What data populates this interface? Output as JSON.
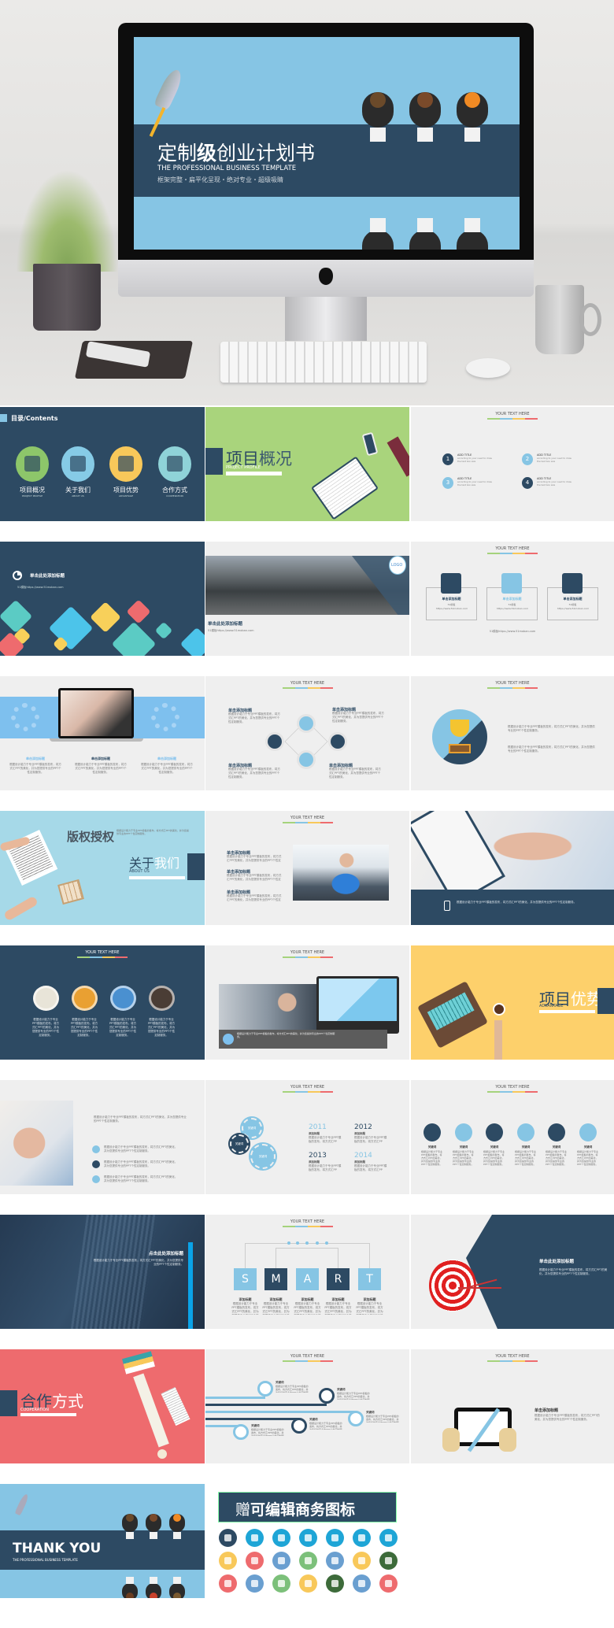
{
  "hero": {
    "title_a": "定制",
    "title_b": "级",
    "title_c": "创业计划书",
    "subtitle": "THE PROFESSIONAL BUSINESS TEMPLATE",
    "tagline": "框架完整・扁平化呈现・绝对专业・超级吸睛"
  },
  "common": {
    "header": "YOUR TEXT HERE",
    "filler": "根据设计能力于专业PPT模板的发布，将方式汇PPT的美化，并为您提供专业的PPT个性定制服务。",
    "url": "51模板https://www.51moban.com",
    "url_short": "51模板 https://www.51moban.com",
    "add_title": "单击添加标题",
    "add_title_here": "单击此处添加标题",
    "click_title_here": "点击此处添加标题",
    "keyword": "关键词",
    "add_heading": "添加标题",
    "logo": "LOGO"
  },
  "colors": {
    "navy": "#2d4a63",
    "light_blue": "#86c5e4",
    "green": "#a9d47c",
    "yellow": "#fdd06b",
    "red": "#ee6b6e",
    "gray": "#efefef"
  },
  "contents": {
    "title": "目录/Contents",
    "items": [
      {
        "label": "项目概况",
        "sub": "PROJECT PROFILE",
        "color": "#8dc66a",
        "icon": "laptop-icon"
      },
      {
        "label": "关于我们",
        "sub": "ABOUT US",
        "color": "#86cbe6",
        "icon": "document-magnifier-icon"
      },
      {
        "label": "项目优势",
        "sub": "ADVANTAGE",
        "color": "#f8c85a",
        "icon": "briefcase-clock-icon"
      },
      {
        "label": "合作方式",
        "sub": "COOPERATION",
        "color": "#8fd3d8",
        "icon": "handshake-icon"
      }
    ]
  },
  "profile": {
    "title_a": "项目",
    "title_b": "概况",
    "sub": "PROJECT PROFILE"
  },
  "numbered": {
    "items": [
      {
        "num": "1",
        "title": "ADD TITLE",
        "desc": "according to your need to draw the text box size",
        "color": "#2d4a63"
      },
      {
        "num": "2",
        "title": "ADD TITLE",
        "desc": "according to your need to draw the text box size",
        "color": "#86c5e4"
      },
      {
        "num": "3",
        "title": "ADD TITLE",
        "desc": "according to your need to draw the text box size",
        "color": "#86c5e4"
      },
      {
        "num": "4",
        "title": "ADD TITLE",
        "desc": "according to your need to draw the text box size",
        "color": "#2d4a63"
      }
    ]
  },
  "three_boxes": {
    "items": [
      {
        "icon": "camera-icon",
        "color": "#2d4a63",
        "label": "51模板"
      },
      {
        "icon": "box-icon",
        "color": "#86c5e4",
        "label": "51模板"
      },
      {
        "icon": "pie-chart-icon",
        "color": "#2d4a63",
        "label": "51模板"
      }
    ]
  },
  "about": {
    "copyright": "版权授权",
    "title_a": "关于",
    "title_b": "我们",
    "sub": "ABOUT US"
  },
  "medals": {
    "items": [
      {
        "icon": "medal-icon",
        "color": "#e8e4d8"
      },
      {
        "icon": "chat-bubble-icon",
        "color": "#e9a032"
      },
      {
        "icon": "tv-icon",
        "color": "#4a90d0"
      },
      {
        "icon": "picture-icon",
        "color": "#4a3d35"
      }
    ]
  },
  "advantage": {
    "title_a": "项目",
    "title_b": "优势",
    "sub": "ADVANTAGE"
  },
  "timeline": {
    "years": [
      {
        "year": "2011",
        "color": "#86c5e4"
      },
      {
        "year": "2012",
        "color": "#2d4a63"
      },
      {
        "year": "2013",
        "color": "#2d4a63"
      },
      {
        "year": "2014",
        "color": "#86c5e4"
      }
    ]
  },
  "six_icons": {
    "items": [
      {
        "icon": "edit-icon",
        "color": "#2d4a63"
      },
      {
        "icon": "gear-icon",
        "color": "#86c5e4"
      },
      {
        "icon": "refresh-icon",
        "color": "#2d4a63"
      },
      {
        "icon": "sync-icon",
        "color": "#86c5e4"
      },
      {
        "icon": "flag-icon",
        "color": "#2d4a63"
      },
      {
        "icon": "bag-icon",
        "color": "#86c5e4"
      }
    ]
  },
  "smart": {
    "letters": [
      {
        "letter": "S",
        "color": "#86c5e4"
      },
      {
        "letter": "M",
        "color": "#2d4a63"
      },
      {
        "letter": "A",
        "color": "#86c5e4"
      },
      {
        "letter": "R",
        "color": "#2d4a63"
      },
      {
        "letter": "T",
        "color": "#86c5e4"
      }
    ]
  },
  "cooperation": {
    "title_a": "合作",
    "title_b": "方式",
    "sub": "COOPERATION"
  },
  "thanks": {
    "title": "THANK YOU",
    "sub": "THE PROFESSIONAL BUSINESS TEMPLATE"
  },
  "icons_panel": {
    "title_a": "赠",
    "title_b": "可编辑商务图标",
    "icons": [
      {
        "name": "rocket-icon",
        "color": "#2d4a63"
      },
      {
        "name": "balloon-icon",
        "color": "#1ea5d6"
      },
      {
        "name": "train-icon",
        "color": "#1ea5d6"
      },
      {
        "name": "cable-car-icon",
        "color": "#1ea5d6"
      },
      {
        "name": "submarine-icon",
        "color": "#1ea5d6"
      },
      {
        "name": "bicycle-icon",
        "color": "#1ea5d6"
      },
      {
        "name": "tractor-icon",
        "color": "#1ea5d6"
      },
      {
        "name": "card-icon",
        "color": "#f8c85a"
      },
      {
        "name": "handshake-icon",
        "color": "#ee6b6e"
      },
      {
        "name": "cash-hand-icon",
        "color": "#6a9fd0"
      },
      {
        "name": "money-icon",
        "color": "#7cc07a"
      },
      {
        "name": "phone-hand-icon",
        "color": "#6a9fd0"
      },
      {
        "name": "banknote-icon",
        "color": "#f8c85a"
      },
      {
        "name": "hand-coin-icon",
        "color": "#3d6b3a"
      },
      {
        "name": "money-bag-icon",
        "color": "#ee6b6e"
      },
      {
        "name": "contract-icon",
        "color": "#6a9fd0"
      },
      {
        "name": "briefcase-icon",
        "color": "#7cc07a"
      },
      {
        "name": "mobile-icon",
        "color": "#f8c85a"
      },
      {
        "name": "calculator-icon",
        "color": "#3d6b3a"
      },
      {
        "name": "atm-icon",
        "color": "#6a9fd0"
      },
      {
        "name": "tablet-icon",
        "color": "#ee6b6e"
      }
    ]
  }
}
